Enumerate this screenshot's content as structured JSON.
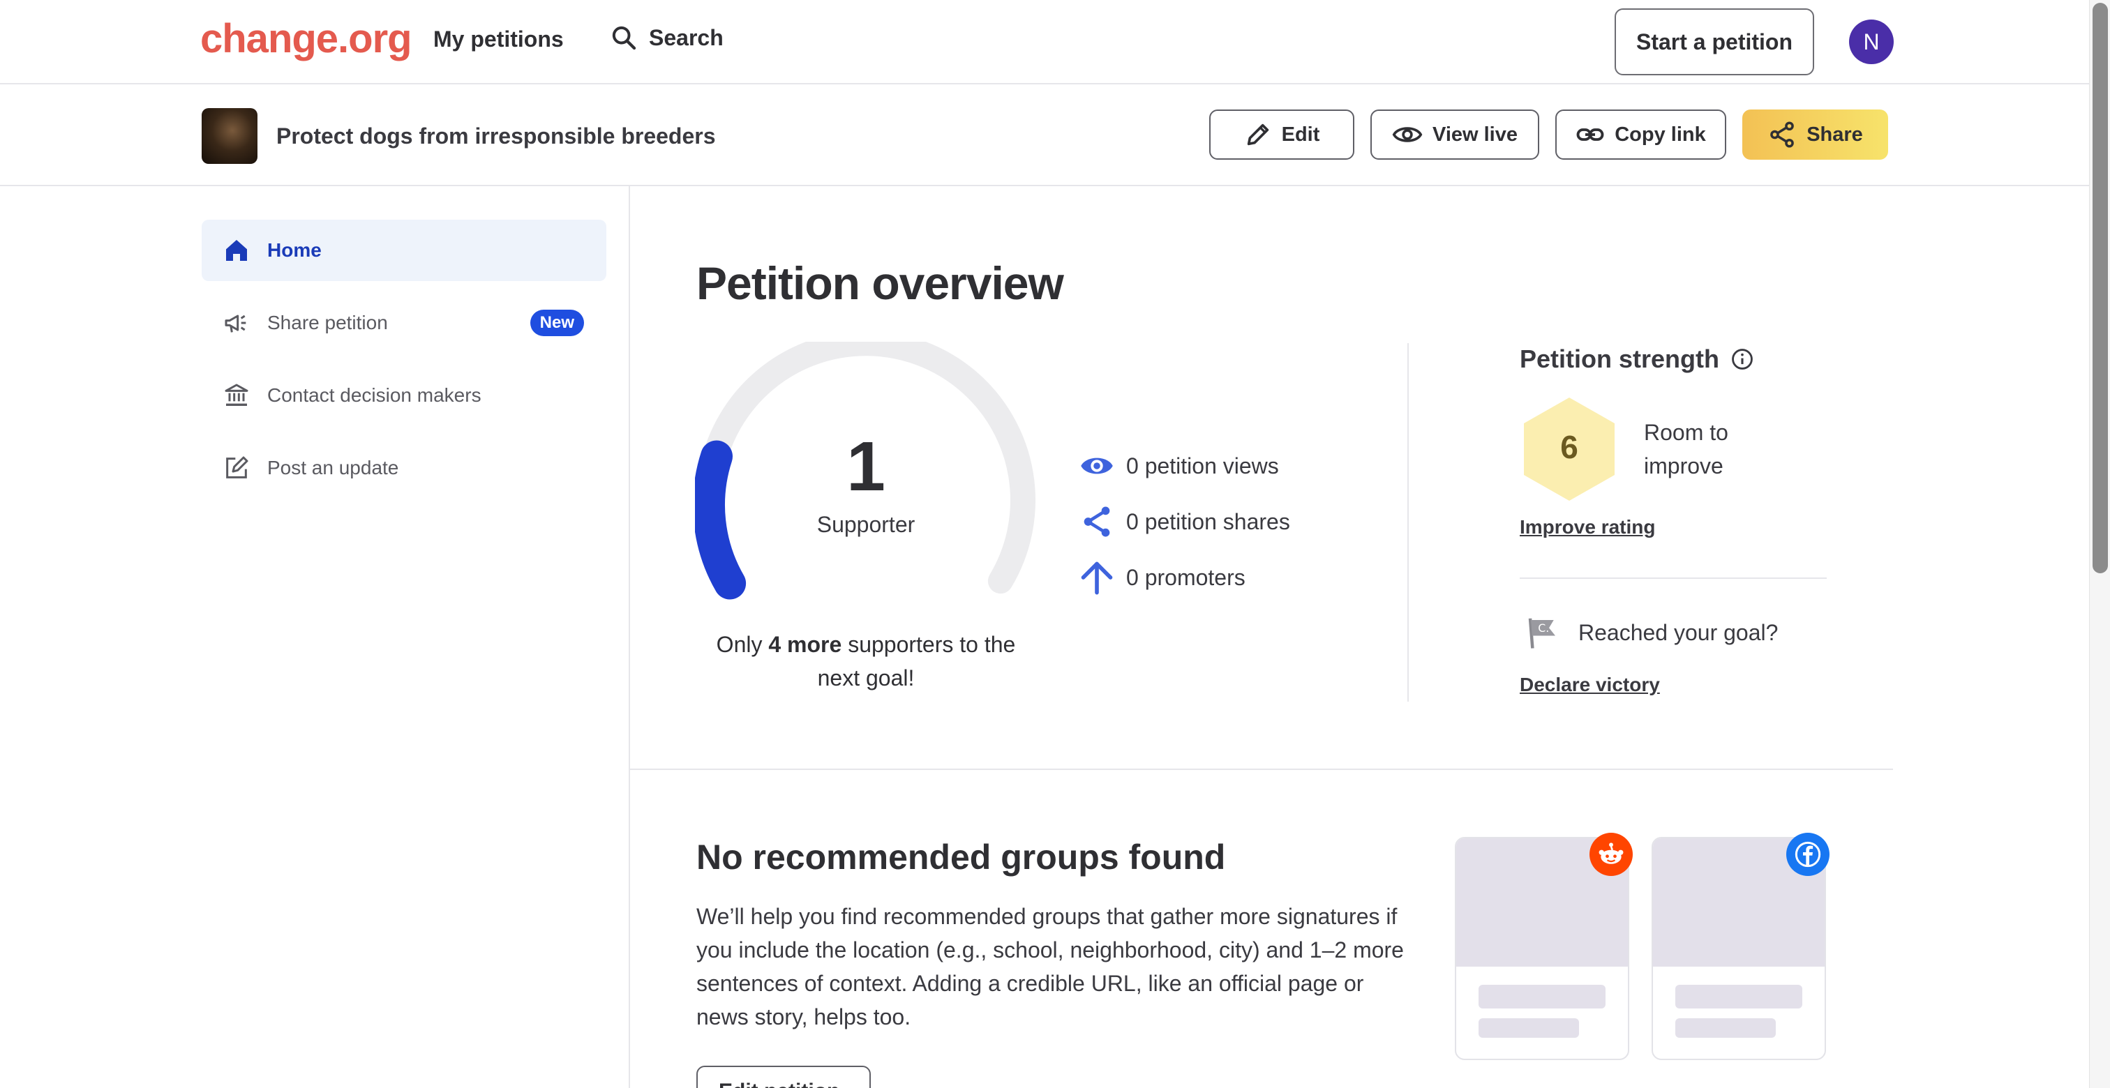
{
  "topnav": {
    "logo": "change.org",
    "my_petitions": "My petitions",
    "search": "Search",
    "start_petition": "Start a petition",
    "avatar_initial": "N"
  },
  "petition_header": {
    "title": "Protect dogs from irresponsible breeders",
    "edit": "Edit",
    "view_live": "View live",
    "copy_link": "Copy link",
    "share": "Share"
  },
  "sidebar": {
    "items": [
      {
        "label": "Home",
        "icon": "home-icon",
        "active": true
      },
      {
        "label": "Share petition",
        "icon": "megaphone-icon",
        "badge": "New"
      },
      {
        "label": "Contact decision makers",
        "icon": "bank-icon"
      },
      {
        "label": "Post an update",
        "icon": "edit-square-icon"
      }
    ]
  },
  "overview": {
    "title": "Petition overview",
    "supporter_count": "1",
    "supporter_label": "Supporter",
    "goal_fraction": 0.2,
    "goal_prefix": "Only ",
    "goal_bold": "4 more",
    "goal_suffix": " supporters to the next goal!",
    "stats": [
      {
        "icon": "eye-icon",
        "text": "0 petition views"
      },
      {
        "icon": "share-icon",
        "text": "0 petition shares"
      },
      {
        "icon": "arrow-up-icon",
        "text": "0 promoters"
      }
    ]
  },
  "strength": {
    "title": "Petition strength",
    "rating": "6",
    "rating_text": "Room to improve",
    "improve_link": "Improve rating",
    "reached_goal": "Reached your goal?",
    "declare_link": "Declare victory"
  },
  "groups": {
    "title": "No recommended groups found",
    "text": "We’ll help you find recommended groups that gather more signatures if you include the location (e.g., school, neighborhood, city) and 1–2 more sentences of context. Adding a credible URL, like an official page or news story, helps too.",
    "button": "Edit petition"
  },
  "colors": {
    "brand": "#e45a4e",
    "accent_blue": "#1f4ee0",
    "share_gradient_start": "#f3c154",
    "share_gradient_end": "#f7e36b"
  }
}
